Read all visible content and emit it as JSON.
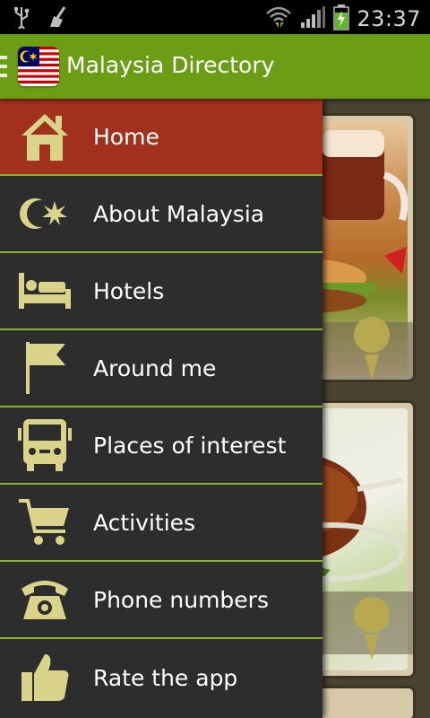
{
  "status_bar": {
    "time": "23:37"
  },
  "action_bar": {
    "title": "Malaysia Directory"
  },
  "drawer": {
    "items": [
      {
        "label": "Home",
        "icon": "home-icon",
        "active": true
      },
      {
        "label": "About Malaysia",
        "icon": "crescent-star-icon",
        "active": false
      },
      {
        "label": "Hotels",
        "icon": "bed-icon",
        "active": false
      },
      {
        "label": "Around me",
        "icon": "flag-icon",
        "active": false
      },
      {
        "label": "Places of interest",
        "icon": "bus-icon",
        "active": false
      },
      {
        "label": "Activities",
        "icon": "cart-icon",
        "active": false
      },
      {
        "label": "Phone numbers",
        "icon": "phone-icon",
        "active": false
      },
      {
        "label": "Rate the app",
        "icon": "thumbs-up-icon",
        "active": false
      }
    ]
  },
  "colors": {
    "accent": "#6b9e15",
    "active_item": "#a1301c",
    "drawer_bg": "#2d2d2d",
    "icon": "#d9d48a"
  }
}
